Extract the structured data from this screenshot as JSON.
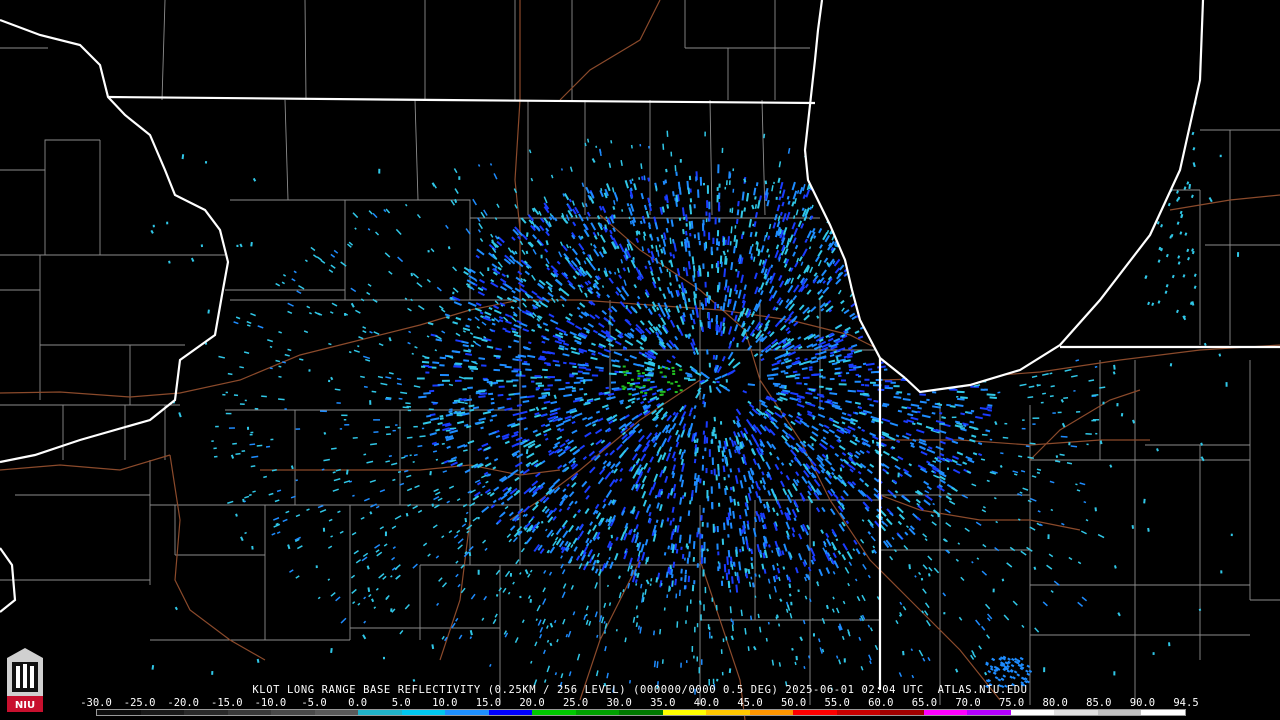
{
  "caption": "KLOT LONG RANGE BASE REFLECTIVITY (0.25KM / 256 LEVEL) (000000/0000 0.5 DEG) 2025-06-01 02:04 UTC  ATLAS.NIU.EDU",
  "logo_text": "NIU",
  "colorbar": {
    "ticks": [
      "-30.0",
      "-25.0",
      "-20.0",
      "-15.0",
      "-10.0",
      "-5.0",
      "0.0",
      "5.0",
      "10.0",
      "15.0",
      "20.0",
      "25.0",
      "30.0",
      "35.0",
      "40.0",
      "45.0",
      "50.0",
      "55.0",
      "60.0",
      "65.0",
      "70.0",
      "75.0",
      "80.0",
      "85.0",
      "90.0",
      "94.5"
    ],
    "colors": [
      "#0d0d0d",
      "#1a1a1a",
      "#2a2a2a",
      "#3a3a3a",
      "#4a4a4a",
      "#5a5a5a",
      "#20b2c8",
      "#00c8f0",
      "#1e90ff",
      "#0000ff",
      "#00c800",
      "#00a000",
      "#007800",
      "#ffff00",
      "#ffc800",
      "#ff9600",
      "#ff0000",
      "#c80000",
      "#a00000",
      "#ff00ff",
      "#b400ff",
      "#ffffff",
      "#e0e0e0",
      "#c0c0c0",
      "#ffffff"
    ]
  },
  "colors": {
    "state_line": "#ffffff",
    "county_line": "#8c8c8c",
    "highway": "#8b4a2b",
    "echo_light": "#30c8e8",
    "echo_mid": "#1e8cff",
    "echo_strong": "#1a3cff",
    "echo_green": "#22c022"
  }
}
